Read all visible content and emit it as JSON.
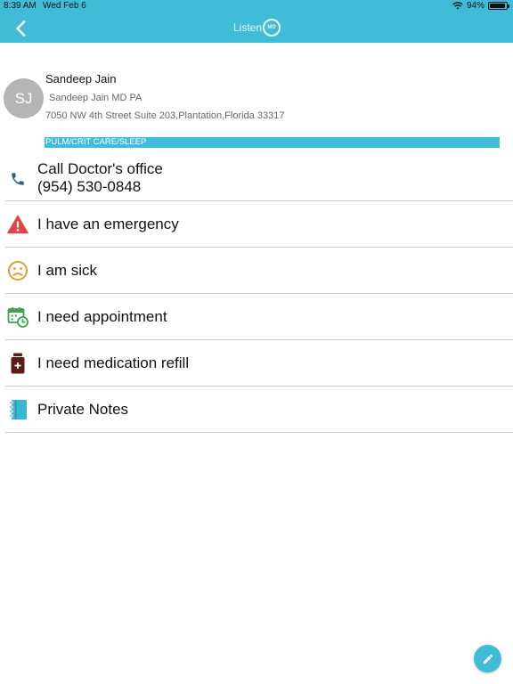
{
  "status_bar": {
    "time": "8:39 AM",
    "date": "Wed Feb 6",
    "battery": "94%",
    "battery_level": 0.94
  },
  "nav": {
    "logo_text": "Listen",
    "logo_badge": "MD",
    "back_icon": "chevron-left-icon"
  },
  "doctor": {
    "initials": "SJ",
    "name": "Sandeep Jain",
    "practice": "Sandeep Jain MD PA",
    "address": "7050 NW 4th Street Suite 203,Plantation,Florida 33317",
    "specialty": "PULM/CRIT CARE/SLEEP"
  },
  "menu": [
    {
      "id": "call",
      "icon": "phone-icon",
      "label": "Call Doctor's office",
      "sub": "(954) 530-0848"
    },
    {
      "id": "emergency",
      "icon": "warning-icon",
      "label": "I have an emergency"
    },
    {
      "id": "sick",
      "icon": "sad-face-icon",
      "label": "I am sick"
    },
    {
      "id": "appointment",
      "icon": "calendar-clock-icon",
      "label": "I need appointment"
    },
    {
      "id": "refill",
      "icon": "medicine-bottle-icon",
      "label": "I need medication refill"
    },
    {
      "id": "notes",
      "icon": "notebook-icon",
      "label": "Private Notes"
    }
  ],
  "fab": {
    "icon": "pencil-icon"
  },
  "colors": {
    "accent": "#40bcd8",
    "warning": "#e14545",
    "sick": "#d9a03a",
    "calendar": "#3aa54a",
    "bottle": "#5b1c18",
    "notebook": "#39b8d6",
    "phone": "#37627a"
  }
}
